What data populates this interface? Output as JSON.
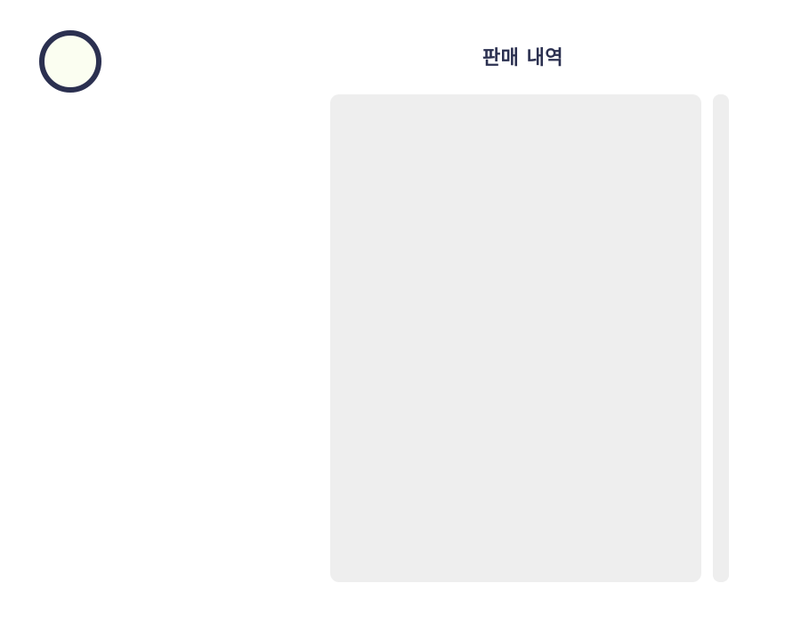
{
  "header": {
    "title": "판매 내역"
  },
  "profile": {
    "avatar_icon": "user-avatar-icon",
    "border_color": "#2b3050",
    "fill_color": "#fbfef1"
  },
  "sales_list": {
    "items": []
  },
  "colors": {
    "text": "#2b3050",
    "panel": "#eeeeee"
  }
}
